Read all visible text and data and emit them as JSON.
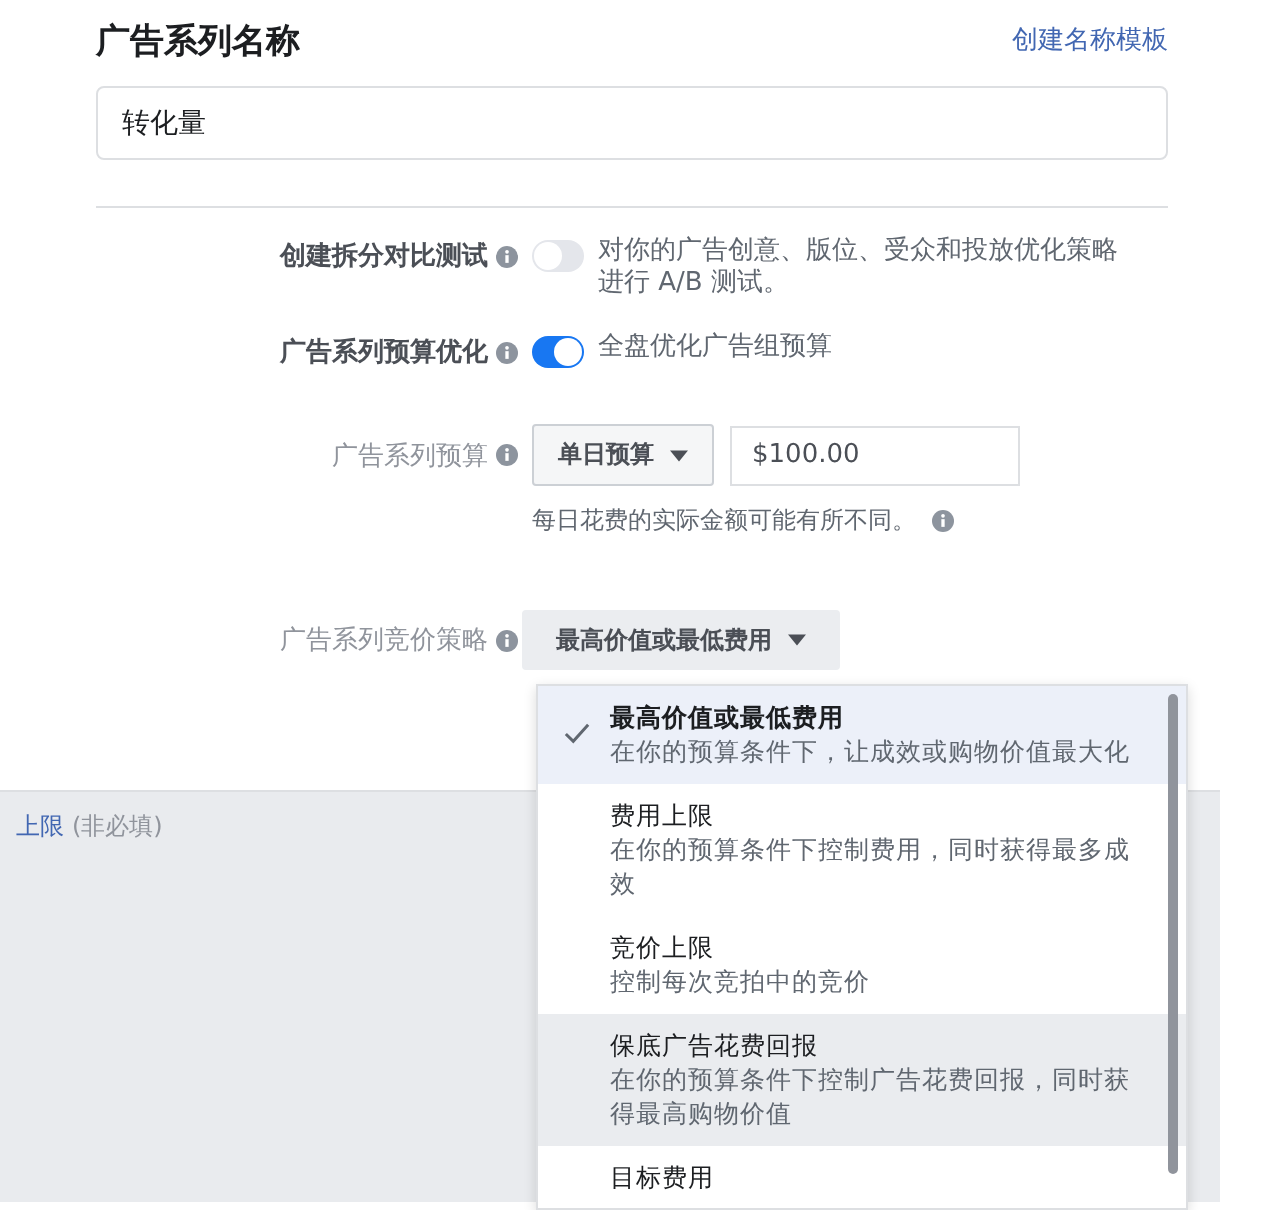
{
  "header": {
    "title": "广告系列名称",
    "link": "创建名称模板"
  },
  "name_field": {
    "value": "转化量"
  },
  "settings": [
    {
      "kind": "toggle",
      "label": "创建拆分对比测试",
      "emphasized": true,
      "on": false,
      "text": "对你的广告创意、版位、受众和投放优化策略进行 A/B 测试。"
    },
    {
      "kind": "toggle",
      "label": "广告系列预算优化",
      "emphasized": true,
      "on": true,
      "text": "全盘优化广告组预算"
    },
    {
      "kind": "budget",
      "label": "广告系列预算",
      "emphasized": false,
      "dropdown": "单日预算",
      "amount": "$100.00",
      "note": "每日花费的实际金额可能有所不同。"
    },
    {
      "kind": "select",
      "label": "广告系列竞价策略",
      "emphasized": false,
      "value": "最高价值或最低费用"
    }
  ],
  "lower_panel": {
    "link": "上限",
    "hint": "(非必填)"
  },
  "bid_menu": {
    "items": [
      {
        "title": "最高价值或最低费用",
        "description": "在你的预算条件下，让成效或购物价值最大化",
        "selected": true,
        "hovered": false
      },
      {
        "title": "费用上限",
        "description": "在你的预算条件下控制费用，同时获得最多成效",
        "selected": false,
        "hovered": false
      },
      {
        "title": "竞价上限",
        "description": "控制每次竞拍中的竞价",
        "selected": false,
        "hovered": false
      },
      {
        "title": "保底广告花费回报",
        "description": "在你的预算条件下控制广告花费回报，同时获得最高购物价值",
        "selected": false,
        "hovered": true
      },
      {
        "title": "目标费用",
        "selected": false,
        "hovered": false
      }
    ]
  }
}
